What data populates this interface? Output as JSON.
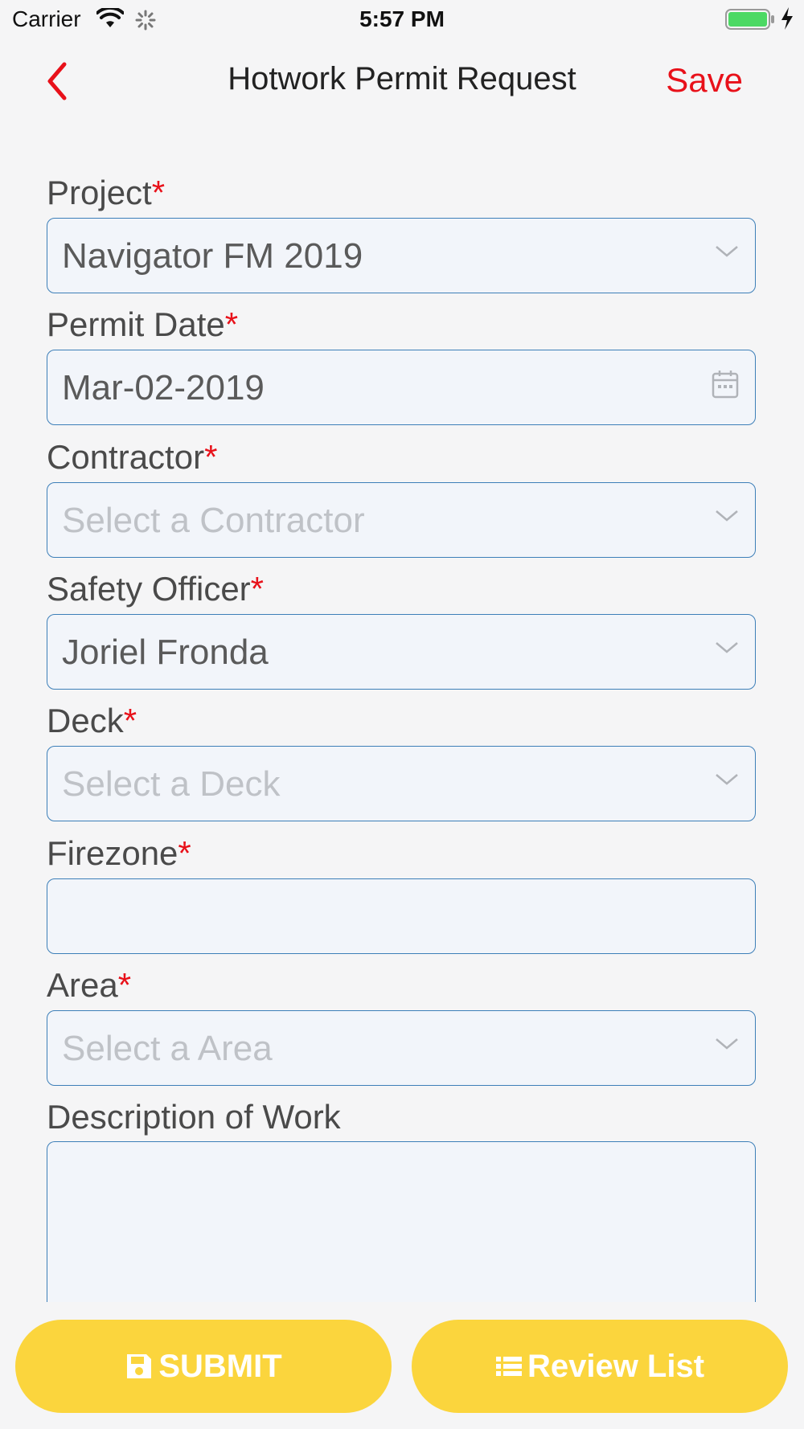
{
  "status_bar": {
    "carrier": "Carrier",
    "time": "5:57 PM",
    "battery_color": "#4cd964"
  },
  "nav": {
    "back_icon": "chevron-left-icon",
    "title": "Hotwork Permit Request",
    "save_label": "Save",
    "accent": "#e8111a"
  },
  "form": {
    "required_mark": "*",
    "project": {
      "label": "Project",
      "value": "Navigator FM 2019",
      "icon": "chevron-down-icon"
    },
    "permit_date": {
      "label": "Permit Date",
      "value": "Mar-02-2019",
      "icon": "calendar-icon"
    },
    "contractor": {
      "label": "Contractor",
      "placeholder": "Select a Contractor",
      "icon": "chevron-down-icon"
    },
    "safety_officer": {
      "label": "Safety Officer",
      "value": "Joriel Fronda",
      "icon": "chevron-down-icon"
    },
    "deck": {
      "label": "Deck",
      "placeholder": "Select a Deck",
      "icon": "chevron-down-icon"
    },
    "firezone": {
      "label": "Firezone",
      "value": ""
    },
    "area": {
      "label": "Area",
      "placeholder": "Select a Area",
      "icon": "chevron-down-icon"
    },
    "description": {
      "label": "Description of Work",
      "value": ""
    }
  },
  "buttons": {
    "submit_label": "SUBMIT",
    "submit_icon": "save-icon",
    "review_label": "Review List",
    "review_icon": "list-icon",
    "color": "#fbd53d"
  }
}
